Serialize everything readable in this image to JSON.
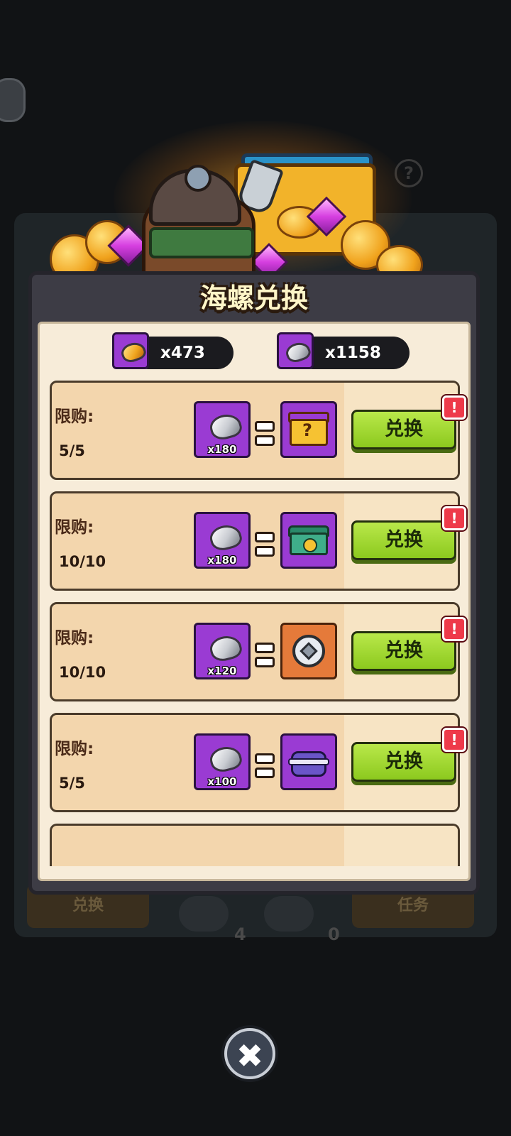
{
  "background": {
    "tab_exchange": "兑换",
    "tab_tasks": "任务",
    "count_left": "4",
    "count_right": "0"
  },
  "modal": {
    "title": "海螺兑换"
  },
  "currencies": [
    {
      "icon": "gold-conch-icon",
      "amount": "x473"
    },
    {
      "icon": "silver-conch-icon",
      "amount": "x1158"
    }
  ],
  "offers": [
    {
      "limit_label": "限购:",
      "limit_value": "5/5",
      "cost_icon": "silver-conch-icon",
      "cost": "x180",
      "reward_icon": "mystery-chest-icon",
      "button": "兑换",
      "badge": "!"
    },
    {
      "limit_label": "限购:",
      "limit_value": "10/10",
      "cost_icon": "silver-conch-icon",
      "cost": "x180",
      "reward_icon": "green-paw-chest-icon",
      "button": "兑换",
      "badge": "!"
    },
    {
      "limit_label": "限购:",
      "limit_value": "10/10",
      "cost_icon": "silver-conch-icon",
      "cost": "x120",
      "reward_icon": "silver-ring-icon",
      "button": "兑换",
      "badge": "!"
    },
    {
      "limit_label": "限购:",
      "limit_value": "5/5",
      "cost_icon": "silver-conch-icon",
      "cost": "x100",
      "reward_icon": "purple-chest-icon",
      "button": "兑换",
      "badge": "!"
    }
  ],
  "close_button": "✖"
}
